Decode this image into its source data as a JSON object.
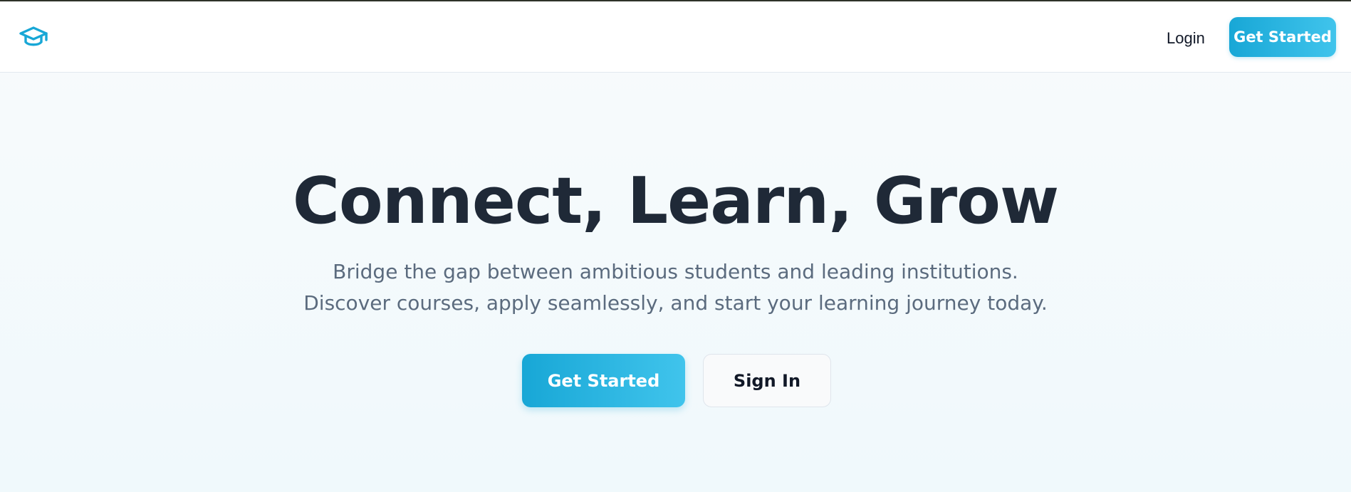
{
  "header": {
    "logo_icon": "graduation-cap-icon",
    "login_label": "Login",
    "cta_label": "Get Started"
  },
  "hero": {
    "title": "Connect, Learn, Grow",
    "subtitle_line1": "Bridge the gap between ambitious students and leading institutions.",
    "subtitle_line2": "Discover courses, apply seamlessly, and start your learning journey today.",
    "primary_label": "Get Started",
    "secondary_label": "Sign In"
  },
  "colors": {
    "accent": "#18a7d6",
    "accent_light": "#40c4ec",
    "heading": "#1f2937",
    "muted": "#5b6b7e"
  }
}
